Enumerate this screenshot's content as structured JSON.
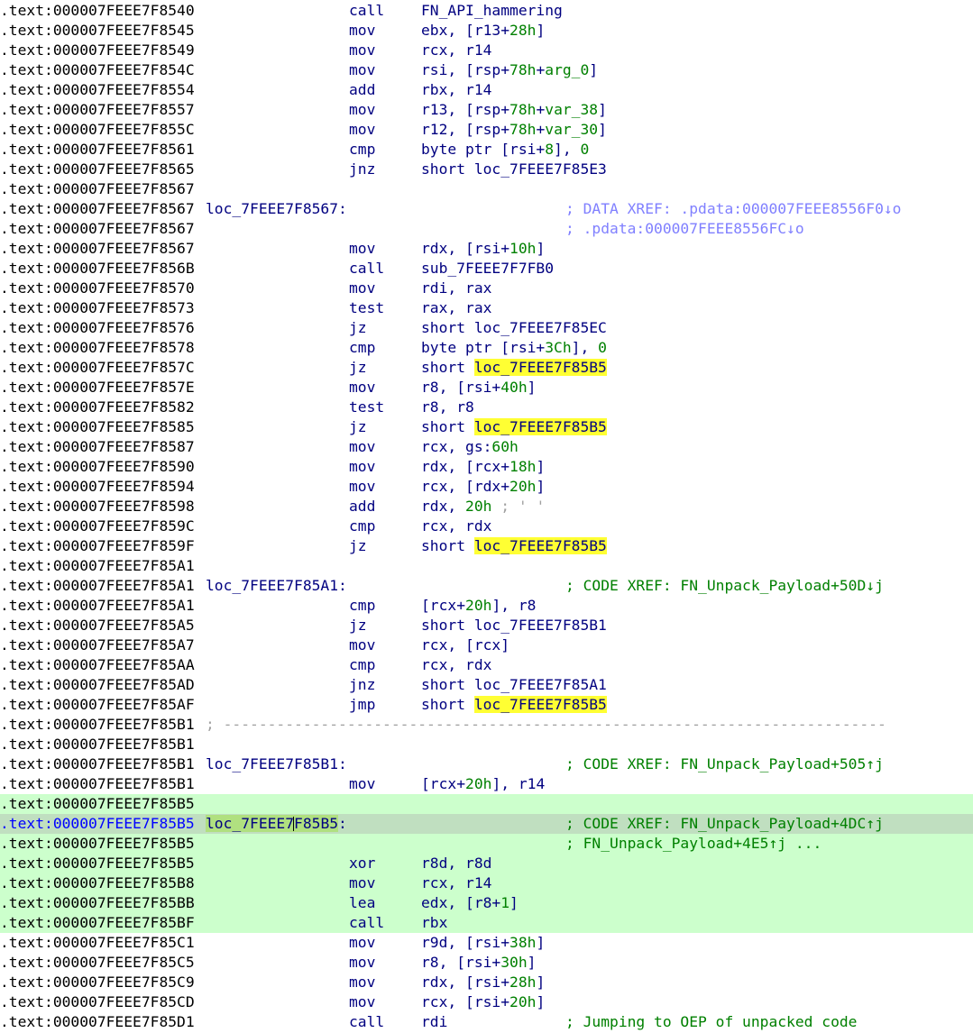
{
  "lines": [
    {
      "addr": ".text:000007FEEE7F8540",
      "mn": "call",
      "op": [
        {
          "t": "FN_API_hammering"
        }
      ]
    },
    {
      "addr": ".text:000007FEEE7F8545",
      "mn": "mov",
      "op": [
        {
          "t": "ebx, [r13+"
        },
        {
          "t": "28h",
          "k": "num"
        },
        {
          "t": "]"
        }
      ]
    },
    {
      "addr": ".text:000007FEEE7F8549",
      "mn": "mov",
      "op": [
        {
          "t": "rcx, r14"
        }
      ]
    },
    {
      "addr": ".text:000007FEEE7F854C",
      "mn": "mov",
      "op": [
        {
          "t": "rsi, [rsp+"
        },
        {
          "t": "78h",
          "k": "num"
        },
        {
          "t": "+"
        },
        {
          "t": "arg_0",
          "k": "num"
        },
        {
          "t": "]"
        }
      ]
    },
    {
      "addr": ".text:000007FEEE7F8554",
      "mn": "add",
      "op": [
        {
          "t": "rbx, r14"
        }
      ]
    },
    {
      "addr": ".text:000007FEEE7F8557",
      "mn": "mov",
      "op": [
        {
          "t": "r13, [rsp+"
        },
        {
          "t": "78h",
          "k": "num"
        },
        {
          "t": "+"
        },
        {
          "t": "var_38",
          "k": "num"
        },
        {
          "t": "]"
        }
      ]
    },
    {
      "addr": ".text:000007FEEE7F855C",
      "mn": "mov",
      "op": [
        {
          "t": "r12, [rsp+"
        },
        {
          "t": "78h",
          "k": "num"
        },
        {
          "t": "+"
        },
        {
          "t": "var_30",
          "k": "num"
        },
        {
          "t": "]"
        }
      ]
    },
    {
      "addr": ".text:000007FEEE7F8561",
      "mn": "cmp",
      "op": [
        {
          "t": "byte ptr [rsi+"
        },
        {
          "t": "8",
          "k": "num"
        },
        {
          "t": "], "
        },
        {
          "t": "0",
          "k": "num"
        }
      ]
    },
    {
      "addr": ".text:000007FEEE7F8565",
      "mn": "jnz",
      "op": [
        {
          "t": "short loc_7FEEE7F85E3"
        }
      ]
    },
    {
      "addr": ".text:000007FEEE7F8567"
    },
    {
      "addr": ".text:000007FEEE7F8567",
      "label": "loc_7FEEE7F8567:",
      "cm": "; DATA XREF: .pdata:000007FEEE8556F0↓o",
      "cmk": "data"
    },
    {
      "addr": ".text:000007FEEE7F8567",
      "cm": "; .pdata:000007FEEE8556FC↓o",
      "cmk": "data"
    },
    {
      "addr": ".text:000007FEEE7F8567",
      "mn": "mov",
      "op": [
        {
          "t": "rdx, [rsi+"
        },
        {
          "t": "10h",
          "k": "num"
        },
        {
          "t": "]"
        }
      ]
    },
    {
      "addr": ".text:000007FEEE7F856B",
      "mn": "call",
      "op": [
        {
          "t": "sub_7FEEE7F7FB0"
        }
      ]
    },
    {
      "addr": ".text:000007FEEE7F8570",
      "mn": "mov",
      "op": [
        {
          "t": "rdi, rax"
        }
      ]
    },
    {
      "addr": ".text:000007FEEE7F8573",
      "mn": "test",
      "op": [
        {
          "t": "rax, rax"
        }
      ]
    },
    {
      "addr": ".text:000007FEEE7F8576",
      "mn": "jz",
      "op": [
        {
          "t": "short loc_7FEEE7F85EC"
        }
      ]
    },
    {
      "addr": ".text:000007FEEE7F8578",
      "mn": "cmp",
      "op": [
        {
          "t": "byte ptr [rsi+"
        },
        {
          "t": "3Ch",
          "k": "num"
        },
        {
          "t": "], "
        },
        {
          "t": "0",
          "k": "num"
        }
      ]
    },
    {
      "addr": ".text:000007FEEE7F857C",
      "mn": "jz",
      "op": [
        {
          "t": "short "
        },
        {
          "t": "loc_7FEEE7F85B5",
          "k": "hl"
        }
      ]
    },
    {
      "addr": ".text:000007FEEE7F857E",
      "mn": "mov",
      "op": [
        {
          "t": "r8, [rsi+"
        },
        {
          "t": "40h",
          "k": "num"
        },
        {
          "t": "]"
        }
      ]
    },
    {
      "addr": ".text:000007FEEE7F8582",
      "mn": "test",
      "op": [
        {
          "t": "r8, r8"
        }
      ]
    },
    {
      "addr": ".text:000007FEEE7F8585",
      "mn": "jz",
      "op": [
        {
          "t": "short "
        },
        {
          "t": "loc_7FEEE7F85B5",
          "k": "hl"
        }
      ]
    },
    {
      "addr": ".text:000007FEEE7F8587",
      "mn": "mov",
      "op": [
        {
          "t": "rcx, gs:"
        },
        {
          "t": "60h",
          "k": "num"
        }
      ]
    },
    {
      "addr": ".text:000007FEEE7F8590",
      "mn": "mov",
      "op": [
        {
          "t": "rdx, [rcx+"
        },
        {
          "t": "18h",
          "k": "num"
        },
        {
          "t": "]"
        }
      ]
    },
    {
      "addr": ".text:000007FEEE7F8594",
      "mn": "mov",
      "op": [
        {
          "t": "rcx, [rdx+"
        },
        {
          "t": "20h",
          "k": "num"
        },
        {
          "t": "]"
        }
      ]
    },
    {
      "addr": ".text:000007FEEE7F8598",
      "mn": "add",
      "op": [
        {
          "t": "rdx, "
        },
        {
          "t": "20h",
          "k": "num"
        },
        {
          "t": " ; ' '",
          "k": "cm"
        }
      ]
    },
    {
      "addr": ".text:000007FEEE7F859C",
      "mn": "cmp",
      "op": [
        {
          "t": "rcx, rdx"
        }
      ]
    },
    {
      "addr": ".text:000007FEEE7F859F",
      "mn": "jz",
      "op": [
        {
          "t": "short "
        },
        {
          "t": "loc_7FEEE7F85B5",
          "k": "hl"
        }
      ]
    },
    {
      "addr": ".text:000007FEEE7F85A1"
    },
    {
      "addr": ".text:000007FEEE7F85A1",
      "label": "loc_7FEEE7F85A1:",
      "cm": "; CODE XREF: FN_Unpack_Payload+50D↓j",
      "cmk": "code"
    },
    {
      "addr": ".text:000007FEEE7F85A1",
      "mn": "cmp",
      "op": [
        {
          "t": "[rcx+"
        },
        {
          "t": "20h",
          "k": "num"
        },
        {
          "t": "], r8"
        }
      ]
    },
    {
      "addr": ".text:000007FEEE7F85A5",
      "mn": "jz",
      "op": [
        {
          "t": "short loc_7FEEE7F85B1"
        }
      ]
    },
    {
      "addr": ".text:000007FEEE7F85A7",
      "mn": "mov",
      "op": [
        {
          "t": "rcx, [rcx]"
        }
      ]
    },
    {
      "addr": ".text:000007FEEE7F85AA",
      "mn": "cmp",
      "op": [
        {
          "t": "rcx, rdx"
        }
      ]
    },
    {
      "addr": ".text:000007FEEE7F85AD",
      "mn": "jnz",
      "op": [
        {
          "t": "short loc_7FEEE7F85A1"
        }
      ]
    },
    {
      "addr": ".text:000007FEEE7F85AF",
      "mn": "jmp",
      "op": [
        {
          "t": "short "
        },
        {
          "t": "loc_7FEEE7F85B5",
          "k": "hl"
        }
      ]
    },
    {
      "addr": ".text:000007FEEE7F85B1",
      "sep": "; ---------------------------------------------------------------------------"
    },
    {
      "addr": ".text:000007FEEE7F85B1"
    },
    {
      "addr": ".text:000007FEEE7F85B1",
      "label": "loc_7FEEE7F85B1:",
      "cm": "; CODE XREF: FN_Unpack_Payload+505↑j",
      "cmk": "code"
    },
    {
      "addr": ".text:000007FEEE7F85B1",
      "mn": "mov",
      "op": [
        {
          "t": "[rcx+"
        },
        {
          "t": "20h",
          "k": "num"
        },
        {
          "t": "], r14"
        }
      ]
    },
    {
      "addr": ".text:000007FEEE7F85B5",
      "bg": "hl"
    },
    {
      "addr": ".text:000007FEEE7F85B5",
      "bg": "cur",
      "label_parts": [
        "loc_7FEEE7",
        "F85B5",
        ":"
      ],
      "cm": "; CODE XREF: FN_Unpack_Payload+4DC↑j",
      "cmk": "code"
    },
    {
      "addr": ".text:000007FEEE7F85B5",
      "bg": "hl",
      "cm": "; FN_Unpack_Payload+4E5↑j ...",
      "cmk": "code"
    },
    {
      "addr": ".text:000007FEEE7F85B5",
      "bg": "hl",
      "mn": "xor",
      "op": [
        {
          "t": "r8d, r8d"
        }
      ]
    },
    {
      "addr": ".text:000007FEEE7F85B8",
      "bg": "hl",
      "mn": "mov",
      "op": [
        {
          "t": "rcx, r14"
        }
      ]
    },
    {
      "addr": ".text:000007FEEE7F85BB",
      "bg": "hl",
      "mn": "lea",
      "op": [
        {
          "t": "edx, [r8+"
        },
        {
          "t": "1",
          "k": "num"
        },
        {
          "t": "]"
        }
      ]
    },
    {
      "addr": ".text:000007FEEE7F85BF",
      "bg": "hl",
      "mn": "call",
      "op": [
        {
          "t": "rbx"
        }
      ]
    },
    {
      "addr": ".text:000007FEEE7F85C1",
      "mn": "mov",
      "op": [
        {
          "t": "r9d, [rsi+"
        },
        {
          "t": "38h",
          "k": "num"
        },
        {
          "t": "]"
        }
      ]
    },
    {
      "addr": ".text:000007FEEE7F85C5",
      "mn": "mov",
      "op": [
        {
          "t": "r8, [rsi+"
        },
        {
          "t": "30h",
          "k": "num"
        },
        {
          "t": "]"
        }
      ]
    },
    {
      "addr": ".text:000007FEEE7F85C9",
      "mn": "mov",
      "op": [
        {
          "t": "rdx, [rsi+"
        },
        {
          "t": "28h",
          "k": "num"
        },
        {
          "t": "]"
        }
      ]
    },
    {
      "addr": ".text:000007FEEE7F85CD",
      "mn": "mov",
      "op": [
        {
          "t": "rcx, [rsi+"
        },
        {
          "t": "20h",
          "k": "num"
        },
        {
          "t": "]"
        }
      ]
    },
    {
      "addr": ".text:000007FEEE7F85D1",
      "mn": "call",
      "op": [
        {
          "t": "rdi"
        }
      ],
      "cm": "; Jumping to OEP of unpacked code",
      "cmk": "code"
    }
  ]
}
